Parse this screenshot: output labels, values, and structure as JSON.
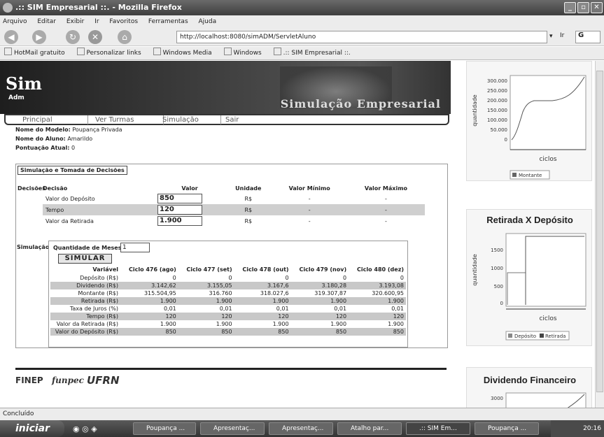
{
  "window": {
    "title": ".:: SIM Empresarial ::. - Mozilla Firefox"
  },
  "menu": [
    "Arquivo",
    "Editar",
    "Exibir",
    "Ir",
    "Favoritos",
    "Ferramentas",
    "Ajuda"
  ],
  "address": {
    "url": "http://localhost:8080/simADM/ServletAluno",
    "go_label": "Ir",
    "search_placeholder": "G"
  },
  "bookmarks": [
    "HotMail gratuito",
    "Personalizar links",
    "Windows Media",
    "Windows",
    ".:: SIM Empresarial ::."
  ],
  "banner": {
    "logo": "Sim",
    "logo_sub": "Adm",
    "title": "Simulação Empresarial"
  },
  "tabs": [
    "Principal",
    "Ver Turmas",
    "Simulação",
    "Sair"
  ],
  "info": {
    "model_label": "Nome do Modelo:",
    "model": "Poupança Privada",
    "student_label": "Nome do Aluno:",
    "student": "Amarildo",
    "score_label": "Pontuação Atual:",
    "score": "0"
  },
  "decisions": {
    "section_title": "Simulação e Tomada de Decisões",
    "side_label": "Decisões",
    "headers": [
      "Decisão",
      "Valor",
      "Unidade",
      "Valor Mínimo",
      "Valor Máximo"
    ],
    "rows": [
      {
        "name": "Valor do Depósito",
        "value": "850",
        "unit": "R$",
        "min": "-",
        "max": "-"
      },
      {
        "name": "Tempo",
        "value": "120",
        "unit": "R$",
        "min": "-",
        "max": "-"
      },
      {
        "name": "Valor da Retirada",
        "value": "1.900",
        "unit": "R$",
        "min": "-",
        "max": "-"
      }
    ]
  },
  "simulation": {
    "side_label": "Simulação",
    "months_label": "Quantidade de Meses:",
    "months_value": "1",
    "button": "SIMULAR",
    "headers": [
      "Variável",
      "Ciclo 476 (ago)",
      "Ciclo 477 (set)",
      "Ciclo 478 (out)",
      "Ciclo 479 (nov)",
      "Ciclo 480 (dez)"
    ],
    "rows": [
      [
        "Depósito (R$)",
        "0",
        "0",
        "0",
        "0",
        "0"
      ],
      [
        "Dividendo (R$)",
        "3.142,62",
        "3.155,05",
        "3.167,6",
        "3.180,28",
        "3.193,08"
      ],
      [
        "Montante (R$)",
        "315.504,95",
        "316.760",
        "318.027,6",
        "319.307,87",
        "320.600,95"
      ],
      [
        "Retirada (R$)",
        "1.900",
        "1.900",
        "1.900",
        "1.900",
        "1.900"
      ],
      [
        "Taxa de Juros (%)",
        "0,01",
        "0,01",
        "0,01",
        "0,01",
        "0,01"
      ],
      [
        "Tempo (R$)",
        "120",
        "120",
        "120",
        "120",
        "120"
      ],
      [
        "Valor da Retirada (R$)",
        "1.900",
        "1.900",
        "1.900",
        "1.900",
        "1.900"
      ],
      [
        "Valor do Depósito (R$)",
        "850",
        "850",
        "850",
        "850",
        "850"
      ]
    ]
  },
  "footer_logos": [
    "FINEP",
    "funpec",
    "UFRN"
  ],
  "charts": {
    "chart1": {
      "ylabel": "quantidade",
      "xlabel": "ciclos",
      "ticks": [
        "300.000",
        "250.000",
        "200.000",
        "150.000",
        "100.000",
        "50.000",
        "0"
      ],
      "legend": [
        "Montante"
      ]
    },
    "chart2": {
      "title": "Retirada X Depósito",
      "ylabel": "quantidade",
      "xlabel": "ciclos",
      "ticks": [
        "1500",
        "1000",
        "500",
        "0"
      ],
      "legend": [
        "Depósito",
        "Retirada"
      ]
    },
    "chart3": {
      "title": "Dividendo Financeiro",
      "ticks": [
        "3000"
      ]
    }
  },
  "chart_data": [
    {
      "type": "line",
      "xlabel": "ciclos",
      "ylabel": "quantidade",
      "ylim": [
        0,
        300000
      ],
      "series": [
        {
          "name": "Montante"
        }
      ]
    },
    {
      "type": "line",
      "title": "Retirada X Depósito",
      "xlabel": "ciclos",
      "ylabel": "quantidade",
      "ylim": [
        0,
        1500
      ],
      "series": [
        {
          "name": "Depósito"
        },
        {
          "name": "Retirada"
        }
      ]
    },
    {
      "type": "line",
      "title": "Dividendo Financeiro"
    }
  ],
  "status": "Concluído",
  "taskbar": {
    "start": "iniciar",
    "tasks": [
      "Poupança ...",
      "Apresentaç...",
      "Apresentaç...",
      "Atalho par...",
      ".:: SIM Em...",
      "Poupança ..."
    ],
    "clock": "20:16"
  }
}
